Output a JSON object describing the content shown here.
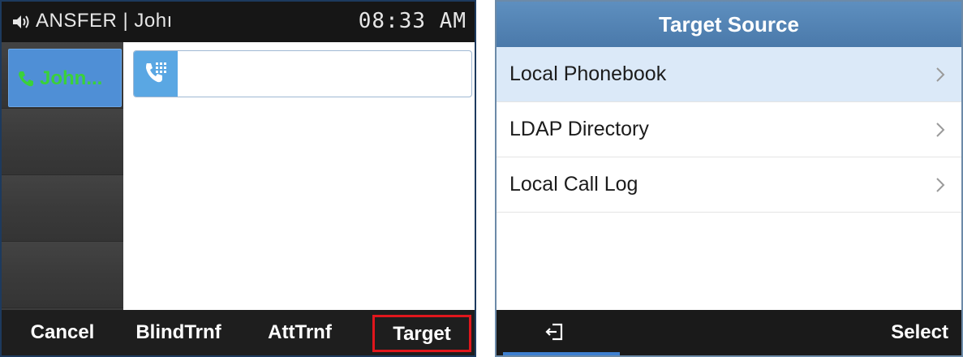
{
  "left_screen": {
    "status": {
      "line_text": "ANSFER | Johı",
      "time": "08:33 AM"
    },
    "active_line": {
      "name": "John..."
    },
    "dial_input": {
      "value": ""
    },
    "softkeys": {
      "cancel": "Cancel",
      "blind_transfer": "BlindTrnf",
      "attended_transfer": "AttTrnf",
      "target": "Target"
    },
    "colors": {
      "highlight_border": "#e1161c",
      "line_name": "#3ad13a",
      "active_line_bg": "#4f8fd6"
    }
  },
  "right_screen": {
    "title": "Target Source",
    "items": [
      {
        "label": "Local Phonebook",
        "selected": true
      },
      {
        "label": "LDAP Directory",
        "selected": false
      },
      {
        "label": "Local Call Log",
        "selected": false
      }
    ],
    "bottom": {
      "back_icon": "back-exit-icon",
      "select": "Select"
    },
    "colors": {
      "header": "#5e8fbf",
      "selected_row": "#dbe9f8",
      "back_underline": "#3d7fd0"
    }
  }
}
